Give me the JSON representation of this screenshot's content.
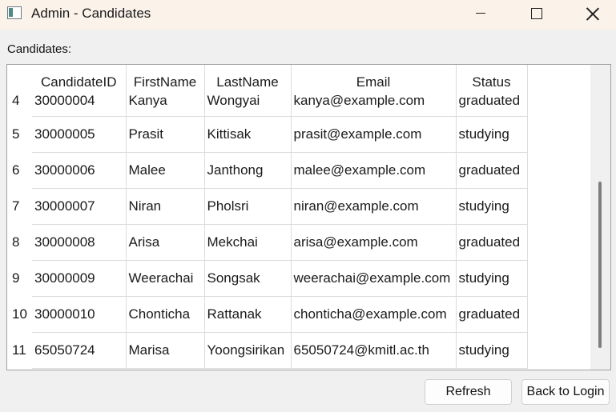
{
  "window": {
    "title": "Admin - Candidates",
    "icon": "app-window-icon"
  },
  "section_label": "Candidates:",
  "table": {
    "columns": [
      "CandidateID",
      "FirstName",
      "LastName",
      "Email",
      "Status"
    ],
    "rows": [
      {
        "num": "4",
        "id": "30000004",
        "first": "Kanya",
        "last": "Wongyai",
        "email": "kanya@example.com",
        "status": "graduated"
      },
      {
        "num": "5",
        "id": "30000005",
        "first": "Prasit",
        "last": "Kittisak",
        "email": "prasit@example.com",
        "status": "studying"
      },
      {
        "num": "6",
        "id": "30000006",
        "first": "Malee",
        "last": "Janthong",
        "email": "malee@example.com",
        "status": "graduated"
      },
      {
        "num": "7",
        "id": "30000007",
        "first": "Niran",
        "last": "Pholsri",
        "email": "niran@example.com",
        "status": "studying"
      },
      {
        "num": "8",
        "id": "30000008",
        "first": "Arisa",
        "last": "Mekchai",
        "email": "arisa@example.com",
        "status": "graduated"
      },
      {
        "num": "9",
        "id": "30000009",
        "first": "Weerachai",
        "last": "Songsak",
        "email": "weerachai@example.com",
        "status": "studying"
      },
      {
        "num": "10",
        "id": "30000010",
        "first": "Chonticha",
        "last": "Rattanak",
        "email": "chonticha@example.com",
        "status": "graduated"
      },
      {
        "num": "11",
        "id": "65050724",
        "first": "Marisa",
        "last": "Yoongsirikan",
        "email": "65050724@kmitl.ac.th",
        "status": "studying"
      }
    ]
  },
  "buttons": {
    "refresh": "Refresh",
    "back": "Back to Login"
  }
}
